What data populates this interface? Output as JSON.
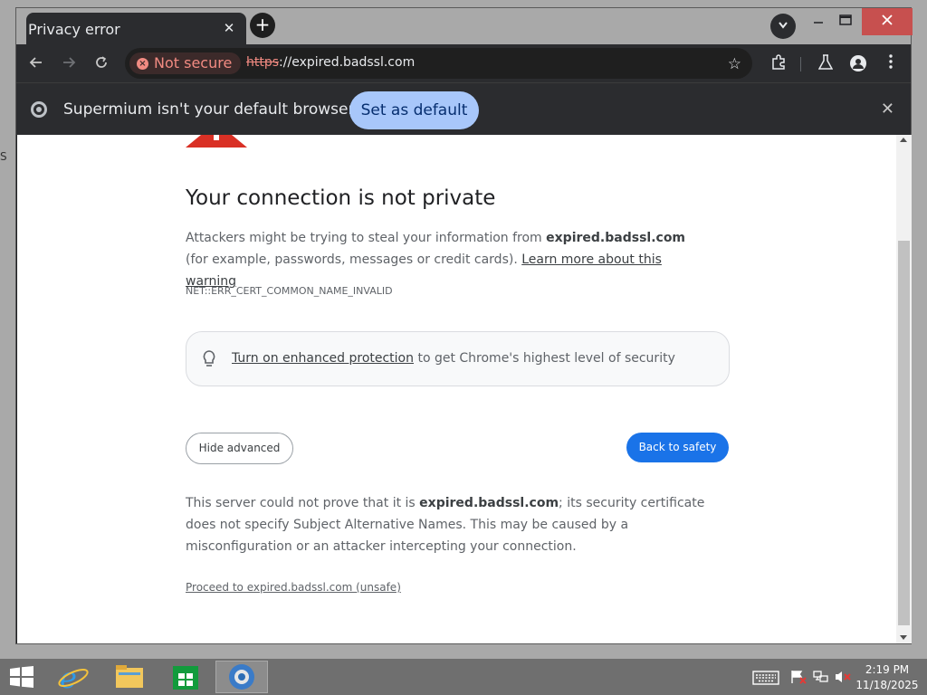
{
  "browser": {
    "tab_title": "Privacy error",
    "tab_close": "✕",
    "new_tab": "+",
    "not_secure": "Not secure",
    "url_scheme": "https",
    "url_rest": "://expired.badssl.com",
    "infobar_text": "Supermium isn't your default browser",
    "infobar_button": "Set as default",
    "infobar_close": "✕"
  },
  "page": {
    "heading": "Your connection is not private",
    "para_prefix": "Attackers might be trying to steal your information from ",
    "para_domain": "expired.badssl.com",
    "para_suffix": " (for example, passwords, messages or credit cards). ",
    "learn_more": "Learn more about this warning",
    "error_code": "NET::ERR_CERT_COMMON_NAME_INVALID",
    "enhanced_link": "Turn on enhanced protection",
    "enhanced_suffix": " to get Chrome's highest level of security",
    "hide_advanced": "Hide advanced",
    "back_to_safety": "Back to safety",
    "detail_prefix": "This server could not prove that it is ",
    "detail_domain": "expired.badssl.com",
    "detail_suffix": "; its security certificate does not specify Subject Alternative Names. This may be caused by a misconfiguration or an attacker intercepting your connection.",
    "proceed_link": "Proceed to expired.badssl.com (unsafe)"
  },
  "taskbar": {
    "time": "2:19 PM",
    "date": "11/18/2025"
  },
  "desktop": {
    "edge_letter": "S"
  },
  "colors": {
    "accent_blue": "#1a73e8",
    "danger_red": "#d93025",
    "infobar_button": "#a8c7fa"
  }
}
